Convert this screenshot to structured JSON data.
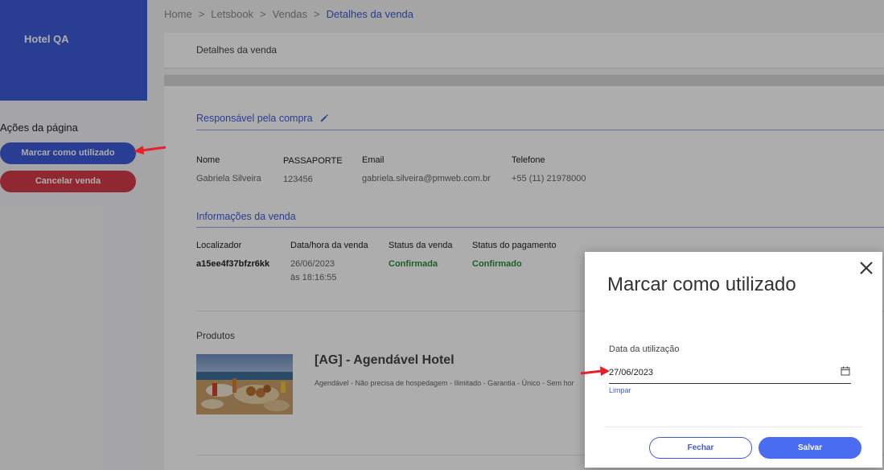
{
  "sidebar": {
    "brand": "Hotel QA",
    "actions_title": "Ações da página",
    "buttons": [
      {
        "label": "Marcar como utilizado"
      },
      {
        "label": "Cancelar venda"
      }
    ]
  },
  "breadcrumb": [
    "Home",
    "Letsbook",
    "Vendas",
    "Detalhes da venda"
  ],
  "page_title": "Detalhes da venda",
  "buyer": {
    "section_title": "Responsável pela compra",
    "fields": [
      {
        "label": "Nome",
        "value": "Gabriela Silveira"
      },
      {
        "label": "PASSAPORTE",
        "value": "123456"
      },
      {
        "label": "Email",
        "value": "gabriela.silveira@pmweb.com.br"
      },
      {
        "label": "Telefone",
        "value": "+55 (11) 21978000"
      }
    ]
  },
  "sale": {
    "section_title": "Informações da venda",
    "fields": [
      {
        "label": "Localizador",
        "value": "a15ee4f37bfzr6kk"
      },
      {
        "label": "Data/hora da venda",
        "value": "26/06/2023",
        "value2": "às 18:16:55"
      },
      {
        "label": "Status da venda",
        "value": "Confirmada"
      },
      {
        "label": "Status do pagamento",
        "value": "Confirmado"
      }
    ]
  },
  "products": {
    "section_title": "Produtos",
    "name": "[AG] - Agendável Hotel",
    "description": "Agendável - Não precisa de hospedagem - Ilimitado - Garantia - Único - Sem hor"
  },
  "modal": {
    "title": "Marcar como utilizado",
    "field_label": "Data da utilização",
    "field_value": "27/06/2023",
    "clear_label": "Limpar",
    "close_label": "Fechar",
    "save_label": "Salvar"
  },
  "colors": {
    "primary": "#3d5bd8",
    "danger": "#d43c4b",
    "success": "#2e8b3e",
    "annotation": "#e8202a"
  }
}
